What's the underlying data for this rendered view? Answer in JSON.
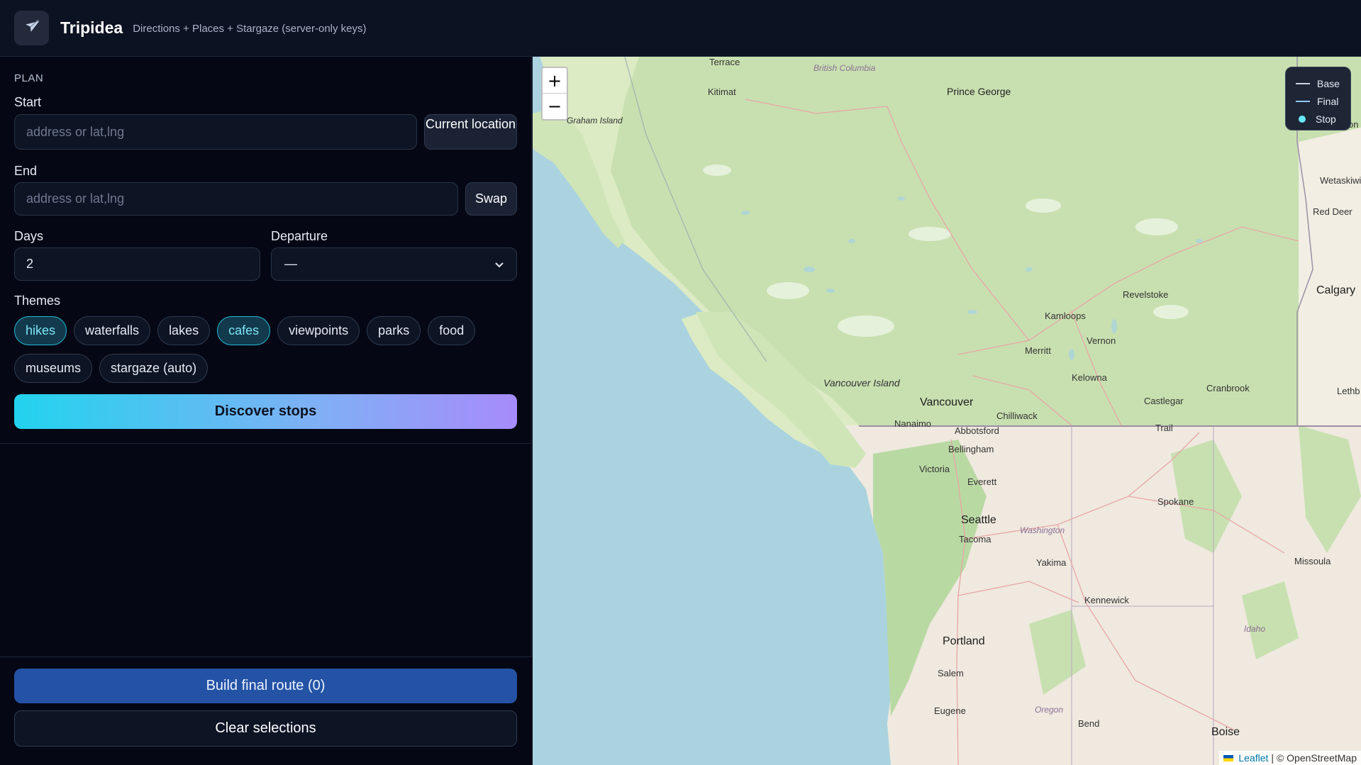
{
  "header": {
    "app_name": "Tripidea",
    "subtitle": "Directions + Places + Stargaze (server-only keys)",
    "logo_icon": "plane-icon"
  },
  "plan": {
    "section_label": "PLAN",
    "start_label": "Start",
    "start_value": "",
    "start_placeholder": "address or lat,lng",
    "current_location_label": "Current location",
    "end_label": "End",
    "end_value": "",
    "end_placeholder": "address or lat,lng",
    "swap_label": "Swap",
    "days_label": "Days",
    "days_value": "2",
    "departure_label": "Departure",
    "departure_value": "—",
    "themes_label": "Themes",
    "themes": [
      {
        "label": "hikes",
        "active": true
      },
      {
        "label": "waterfalls",
        "active": false
      },
      {
        "label": "lakes",
        "active": false
      },
      {
        "label": "cafes",
        "active": true
      },
      {
        "label": "viewpoints",
        "active": false
      },
      {
        "label": "parks",
        "active": false
      },
      {
        "label": "food",
        "active": false
      },
      {
        "label": "museums",
        "active": false
      },
      {
        "label": "stargaze (auto)",
        "active": false
      }
    ],
    "discover_label": "Discover stops"
  },
  "footer": {
    "build_label": "Build final route (0)",
    "clear_label": "Clear selections"
  },
  "map": {
    "zoom_in": "+",
    "zoom_out": "−",
    "legend": [
      {
        "label": "Base",
        "color": "#cbd5e1",
        "kind": "line"
      },
      {
        "label": "Final",
        "color": "#93c5fd",
        "kind": "line"
      },
      {
        "label": "Stop",
        "color": "#67e8f9",
        "kind": "dot"
      }
    ],
    "attribution_link": "Leaflet",
    "attribution_text": "| © OpenStreetMap",
    "labels": [
      "Terrace",
      "British Columbia",
      "Kitimat",
      "Prince George",
      "Graham Island",
      "Revelstoke",
      "Calgary",
      "Red Deer",
      "Wetaskiwin",
      "Kamloops",
      "Vernon",
      "Merritt",
      "Kelowna",
      "Vancouver Island",
      "Vancouver",
      "Chilliwack",
      "Castlegar",
      "Cranbrook",
      "Lethb",
      "Nanaimo",
      "Abbotsford",
      "Bellingham",
      "Trail",
      "Victoria",
      "Everett",
      "Spokane",
      "Seattle",
      "Washington",
      "Tacoma",
      "Yakima",
      "Missoula",
      "Kennewick",
      "Idaho",
      "Portland",
      "Salem",
      "Eugene",
      "Oregon",
      "Bend",
      "Boise",
      "on"
    ]
  },
  "colors": {
    "accent": "#22d3ee",
    "accent_end": "#a78bfa",
    "primary": "#2453a6",
    "chip_active_border": "#21b8d6"
  }
}
